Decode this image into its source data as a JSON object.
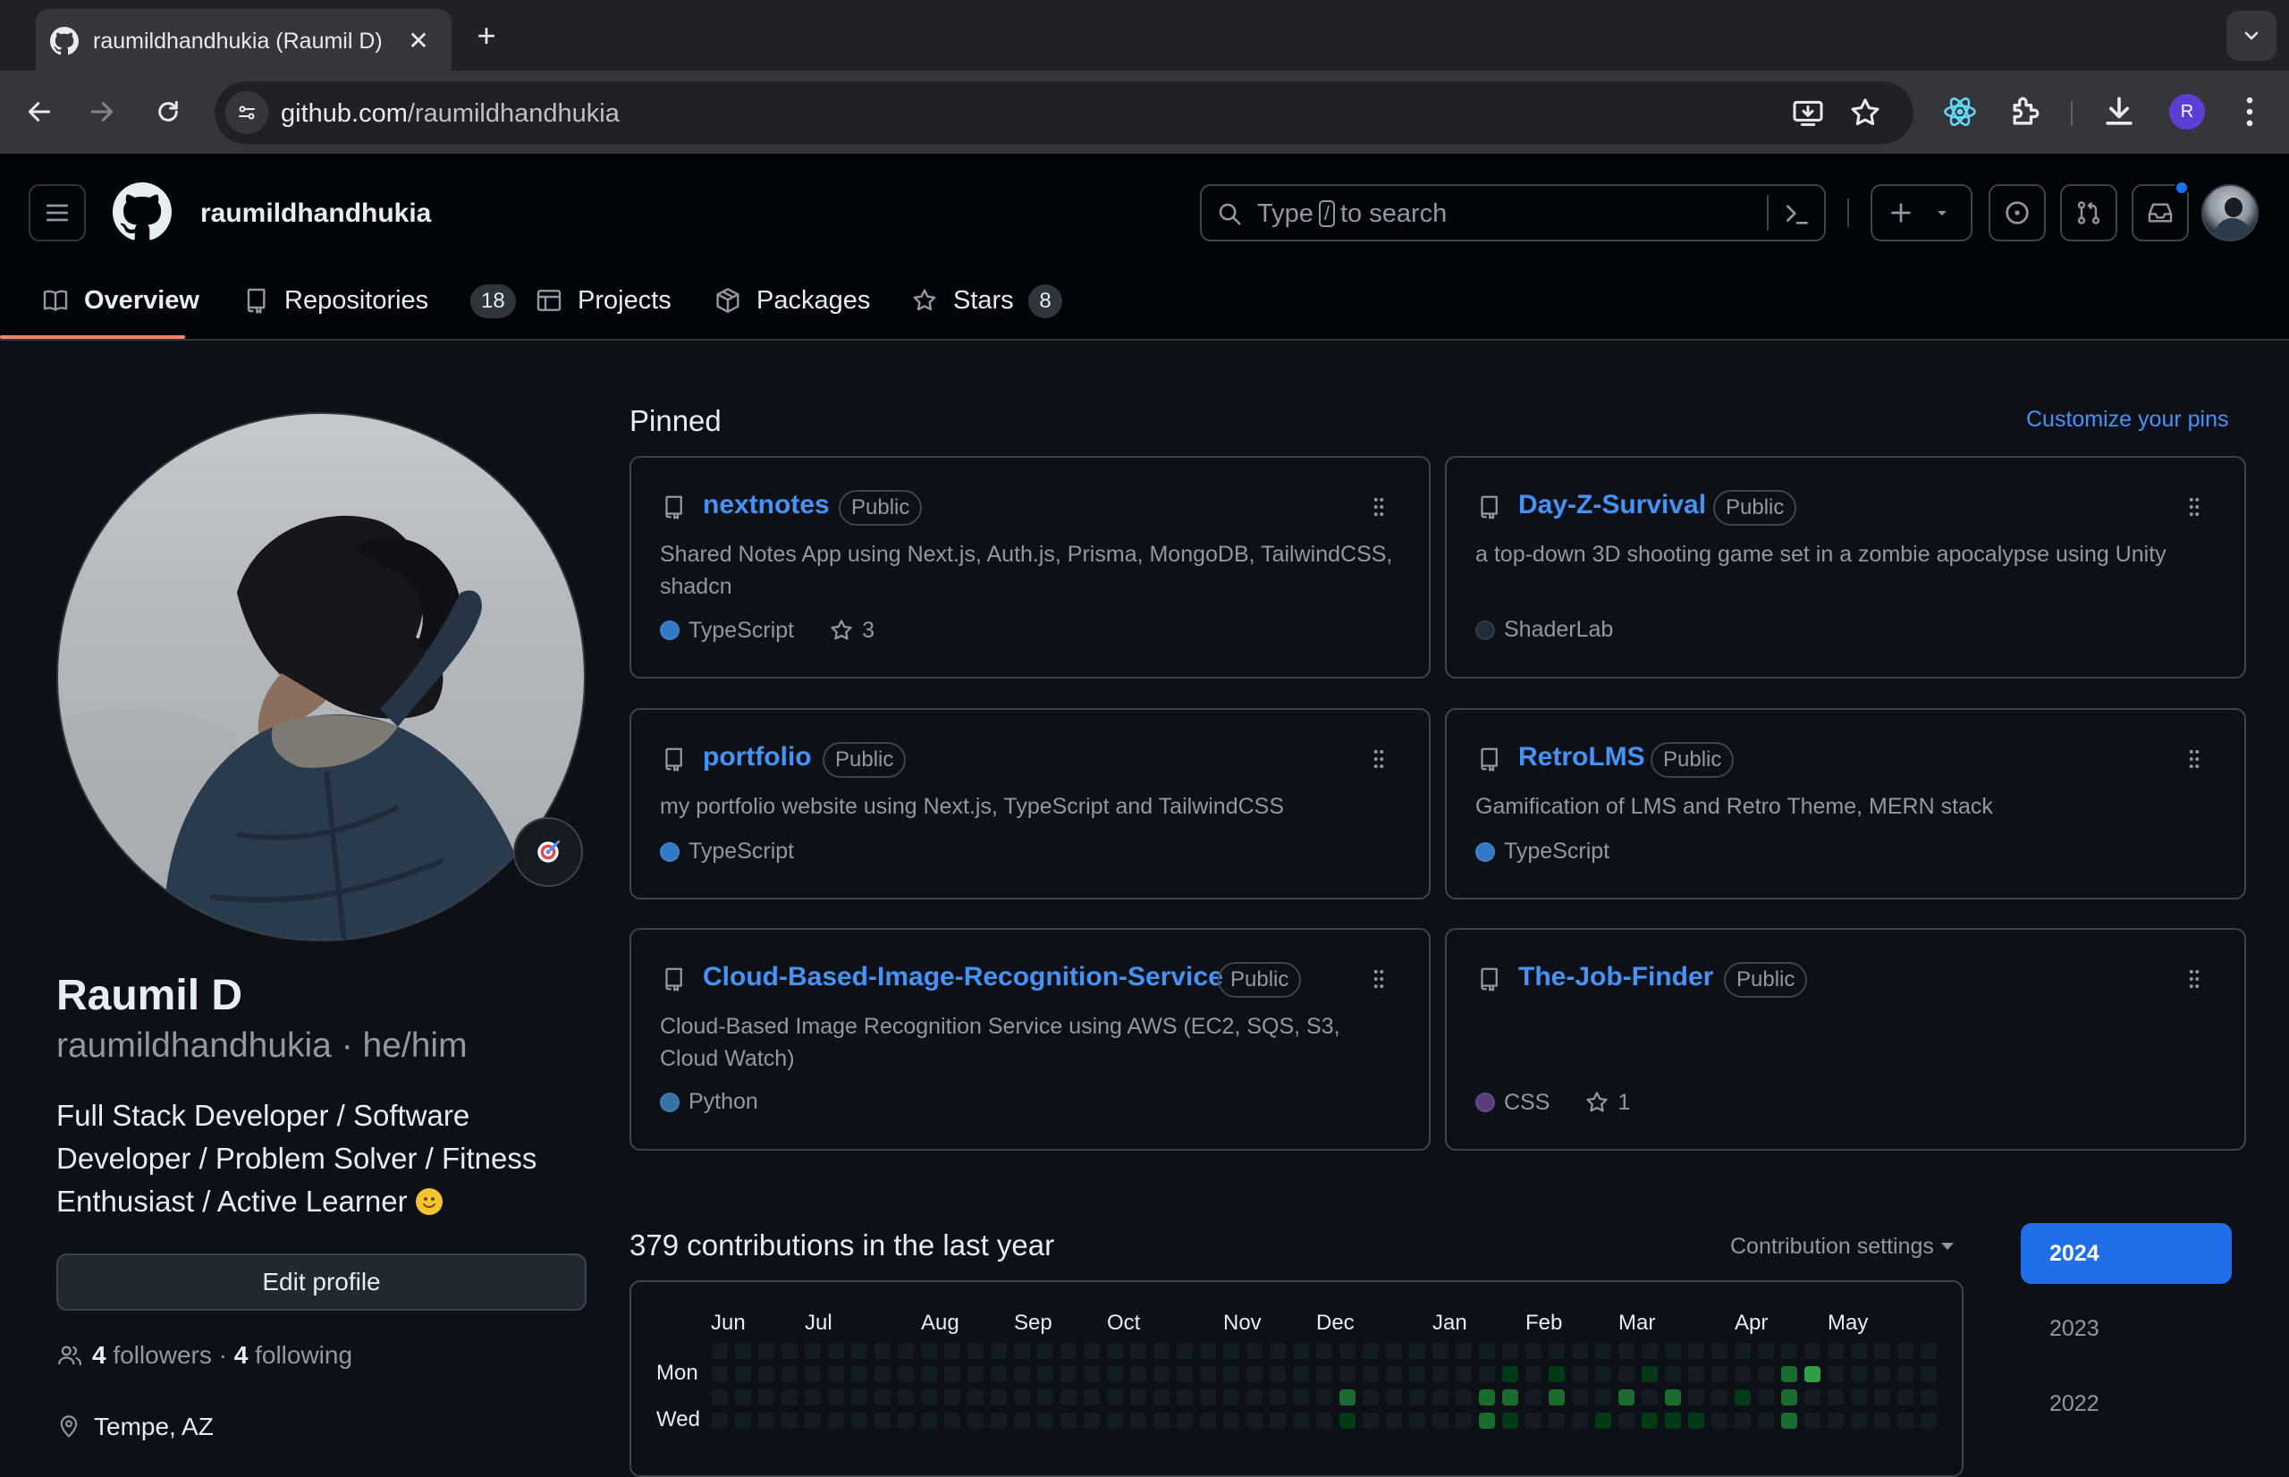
{
  "browser": {
    "tab_title": "raumildhandhukia (Raumil D)",
    "url_host": "github.com",
    "url_path": "/raumildhandhukia",
    "profile_initial": "R"
  },
  "header": {
    "username": "raumildhandhukia",
    "search_before": "Type",
    "search_key": "/",
    "search_after": "to search"
  },
  "nav": {
    "tabs": [
      {
        "label": "Overview",
        "icon": "book-icon"
      },
      {
        "label": "Repositories",
        "count": "18",
        "icon": "repo-icon"
      },
      {
        "label": "Projects",
        "icon": "table-icon"
      },
      {
        "label": "Packages",
        "icon": "package-icon"
      },
      {
        "label": "Stars",
        "count": "8",
        "icon": "star-icon"
      }
    ]
  },
  "profile": {
    "name": "Raumil D",
    "login": "raumildhandhukia · he/him",
    "bio": "Full Stack Developer / Software Developer / Problem Solver / Fitness Enthusiast / Active Learner",
    "edit_label": "Edit profile",
    "followers_count": "4",
    "followers_label": "followers",
    "separator": "·",
    "following_count": "4",
    "following_label": "following",
    "location": "Tempe, AZ"
  },
  "pinned": {
    "title": "Pinned",
    "customize": "Customize your pins",
    "repos": [
      {
        "name": "nextnotes",
        "visibility": "Public",
        "description": "Shared Notes App using Next.js, Auth.js, Prisma, MongoDB, TailwindCSS, shadcn",
        "language": "TypeScript",
        "lang_color": "#3178c6",
        "stars": "3"
      },
      {
        "name": "Day-Z-Survival",
        "visibility": "Public",
        "description": "a top-down 3D shooting game set in a zombie apocalypse using Unity",
        "language": "ShaderLab",
        "lang_color": "#222c37",
        "stars": ""
      },
      {
        "name": "portfolio",
        "visibility": "Public",
        "description": "my portfolio website using Next.js, TypeScript and TailwindCSS",
        "language": "TypeScript",
        "lang_color": "#3178c6",
        "stars": ""
      },
      {
        "name": "RetroLMS",
        "visibility": "Public",
        "description": "Gamification of LMS and Retro Theme, MERN stack",
        "language": "TypeScript",
        "lang_color": "#3178c6",
        "stars": ""
      },
      {
        "name": "Cloud-Based-Image-Recognition-Service",
        "visibility": "Public",
        "description": "Cloud-Based Image Recognition Service using AWS (EC2, SQS, S3, Cloud Watch)",
        "language": "Python",
        "lang_color": "#3572A5",
        "stars": ""
      },
      {
        "name": "The-Job-Finder",
        "visibility": "Public",
        "description": "",
        "language": "CSS",
        "lang_color": "#563d7c",
        "stars": "1"
      }
    ]
  },
  "contributions": {
    "title": "379 contributions in the last year",
    "settings": "Contribution settings",
    "months": [
      "Jun",
      "Jul",
      "Aug",
      "Sep",
      "Oct",
      "Nov",
      "Dec",
      "Jan",
      "Feb",
      "Mar",
      "Apr",
      "May"
    ],
    "days": [
      "Mon",
      "Wed"
    ],
    "years": [
      "2024",
      "2023",
      "2022"
    ],
    "active_year": "2024",
    "active_cells": [
      [
        27,
        2,
        2
      ],
      [
        27,
        3,
        1
      ],
      [
        33,
        2,
        2
      ],
      [
        33,
        3,
        2
      ],
      [
        33,
        4,
        1
      ],
      [
        34,
        1,
        1
      ],
      [
        34,
        2,
        2
      ],
      [
        34,
        3,
        1
      ],
      [
        34,
        4,
        1
      ],
      [
        35,
        4,
        1
      ],
      [
        36,
        1,
        1
      ],
      [
        36,
        2,
        2
      ],
      [
        36,
        4,
        1
      ],
      [
        38,
        3,
        1
      ],
      [
        38,
        4,
        1
      ],
      [
        39,
        2,
        2
      ],
      [
        39,
        4,
        1
      ],
      [
        40,
        1,
        1
      ],
      [
        40,
        3,
        1
      ],
      [
        40,
        4,
        2
      ],
      [
        41,
        2,
        2
      ],
      [
        41,
        4,
        2
      ],
      [
        41,
        3,
        1
      ],
      [
        42,
        3,
        1
      ],
      [
        43,
        4,
        1
      ],
      [
        44,
        2,
        1
      ],
      [
        44,
        4,
        1
      ],
      [
        46,
        1,
        2
      ],
      [
        46,
        2,
        2
      ],
      [
        46,
        3,
        2
      ],
      [
        47,
        1,
        3
      ]
    ]
  }
}
